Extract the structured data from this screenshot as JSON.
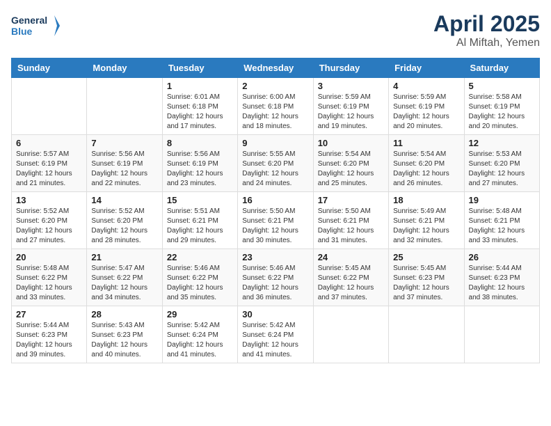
{
  "logo": {
    "line1": "General",
    "line2": "Blue"
  },
  "title": "April 2025",
  "subtitle": "Al Miftah, Yemen",
  "weekdays": [
    "Sunday",
    "Monday",
    "Tuesday",
    "Wednesday",
    "Thursday",
    "Friday",
    "Saturday"
  ],
  "weeks": [
    [
      {
        "day": "",
        "info": ""
      },
      {
        "day": "",
        "info": ""
      },
      {
        "day": "1",
        "info": "Sunrise: 6:01 AM\nSunset: 6:18 PM\nDaylight: 12 hours and 17 minutes."
      },
      {
        "day": "2",
        "info": "Sunrise: 6:00 AM\nSunset: 6:18 PM\nDaylight: 12 hours and 18 minutes."
      },
      {
        "day": "3",
        "info": "Sunrise: 5:59 AM\nSunset: 6:19 PM\nDaylight: 12 hours and 19 minutes."
      },
      {
        "day": "4",
        "info": "Sunrise: 5:59 AM\nSunset: 6:19 PM\nDaylight: 12 hours and 20 minutes."
      },
      {
        "day": "5",
        "info": "Sunrise: 5:58 AM\nSunset: 6:19 PM\nDaylight: 12 hours and 20 minutes."
      }
    ],
    [
      {
        "day": "6",
        "info": "Sunrise: 5:57 AM\nSunset: 6:19 PM\nDaylight: 12 hours and 21 minutes."
      },
      {
        "day": "7",
        "info": "Sunrise: 5:56 AM\nSunset: 6:19 PM\nDaylight: 12 hours and 22 minutes."
      },
      {
        "day": "8",
        "info": "Sunrise: 5:56 AM\nSunset: 6:19 PM\nDaylight: 12 hours and 23 minutes."
      },
      {
        "day": "9",
        "info": "Sunrise: 5:55 AM\nSunset: 6:20 PM\nDaylight: 12 hours and 24 minutes."
      },
      {
        "day": "10",
        "info": "Sunrise: 5:54 AM\nSunset: 6:20 PM\nDaylight: 12 hours and 25 minutes."
      },
      {
        "day": "11",
        "info": "Sunrise: 5:54 AM\nSunset: 6:20 PM\nDaylight: 12 hours and 26 minutes."
      },
      {
        "day": "12",
        "info": "Sunrise: 5:53 AM\nSunset: 6:20 PM\nDaylight: 12 hours and 27 minutes."
      }
    ],
    [
      {
        "day": "13",
        "info": "Sunrise: 5:52 AM\nSunset: 6:20 PM\nDaylight: 12 hours and 27 minutes."
      },
      {
        "day": "14",
        "info": "Sunrise: 5:52 AM\nSunset: 6:20 PM\nDaylight: 12 hours and 28 minutes."
      },
      {
        "day": "15",
        "info": "Sunrise: 5:51 AM\nSunset: 6:21 PM\nDaylight: 12 hours and 29 minutes."
      },
      {
        "day": "16",
        "info": "Sunrise: 5:50 AM\nSunset: 6:21 PM\nDaylight: 12 hours and 30 minutes."
      },
      {
        "day": "17",
        "info": "Sunrise: 5:50 AM\nSunset: 6:21 PM\nDaylight: 12 hours and 31 minutes."
      },
      {
        "day": "18",
        "info": "Sunrise: 5:49 AM\nSunset: 6:21 PM\nDaylight: 12 hours and 32 minutes."
      },
      {
        "day": "19",
        "info": "Sunrise: 5:48 AM\nSunset: 6:21 PM\nDaylight: 12 hours and 33 minutes."
      }
    ],
    [
      {
        "day": "20",
        "info": "Sunrise: 5:48 AM\nSunset: 6:22 PM\nDaylight: 12 hours and 33 minutes."
      },
      {
        "day": "21",
        "info": "Sunrise: 5:47 AM\nSunset: 6:22 PM\nDaylight: 12 hours and 34 minutes."
      },
      {
        "day": "22",
        "info": "Sunrise: 5:46 AM\nSunset: 6:22 PM\nDaylight: 12 hours and 35 minutes."
      },
      {
        "day": "23",
        "info": "Sunrise: 5:46 AM\nSunset: 6:22 PM\nDaylight: 12 hours and 36 minutes."
      },
      {
        "day": "24",
        "info": "Sunrise: 5:45 AM\nSunset: 6:22 PM\nDaylight: 12 hours and 37 minutes."
      },
      {
        "day": "25",
        "info": "Sunrise: 5:45 AM\nSunset: 6:23 PM\nDaylight: 12 hours and 37 minutes."
      },
      {
        "day": "26",
        "info": "Sunrise: 5:44 AM\nSunset: 6:23 PM\nDaylight: 12 hours and 38 minutes."
      }
    ],
    [
      {
        "day": "27",
        "info": "Sunrise: 5:44 AM\nSunset: 6:23 PM\nDaylight: 12 hours and 39 minutes."
      },
      {
        "day": "28",
        "info": "Sunrise: 5:43 AM\nSunset: 6:23 PM\nDaylight: 12 hours and 40 minutes."
      },
      {
        "day": "29",
        "info": "Sunrise: 5:42 AM\nSunset: 6:24 PM\nDaylight: 12 hours and 41 minutes."
      },
      {
        "day": "30",
        "info": "Sunrise: 5:42 AM\nSunset: 6:24 PM\nDaylight: 12 hours and 41 minutes."
      },
      {
        "day": "",
        "info": ""
      },
      {
        "day": "",
        "info": ""
      },
      {
        "day": "",
        "info": ""
      }
    ]
  ]
}
